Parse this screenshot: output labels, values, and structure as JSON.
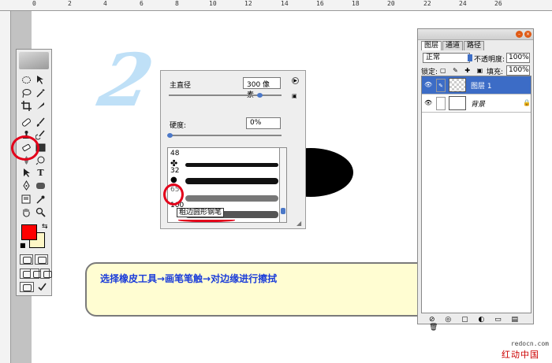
{
  "ruler": {
    "numbers": [
      "0",
      "2",
      "4",
      "6",
      "8",
      "10",
      "12",
      "14",
      "16",
      "18",
      "20",
      "22",
      "24",
      "26"
    ]
  },
  "canvas": {
    "decoration_text": "2"
  },
  "tools": {
    "items": [
      "marquee",
      "move",
      "lasso",
      "magic-wand",
      "crop",
      "slice",
      "healing-brush",
      "brush",
      "clone-stamp",
      "history-brush",
      "eraser",
      "gradient",
      "blur",
      "dodge",
      "path-select",
      "type",
      "pen",
      "shape",
      "notes",
      "eyedropper",
      "hand",
      "zoom"
    ],
    "type_glyph": "T",
    "foreground_color": "#ff0000",
    "background_color": "#fdf6c6"
  },
  "brush_panel": {
    "diameter_label": "主直径",
    "diameter_value": "300 像素",
    "hardness_label": "硬度:",
    "hardness_value": "0%",
    "brush_sizes": [
      "48",
      "32",
      "65",
      "100"
    ],
    "tooltip": "粗边圆形钢笔"
  },
  "caption": {
    "text": "选择橡皮工具→画笔笔触→对边缘进行擦拭"
  },
  "layers_panel": {
    "tabs": [
      "图层",
      "通道",
      "路径"
    ],
    "blend_mode": "正常",
    "opacity_label": "不透明度:",
    "opacity_value": "100%",
    "lock_label": "锁定:",
    "fill_label": "填充:",
    "fill_value": "100%",
    "layers": [
      {
        "name": "图层 1",
        "selected": true
      },
      {
        "name": "背景",
        "selected": false,
        "locked": true
      }
    ]
  },
  "watermark": {
    "url": "redocn.com",
    "site_name": "红动中国"
  },
  "colors": {
    "accent": "#3c6cc6",
    "caption_text": "#1a3cd9",
    "annotation_red": "#e3001a"
  }
}
